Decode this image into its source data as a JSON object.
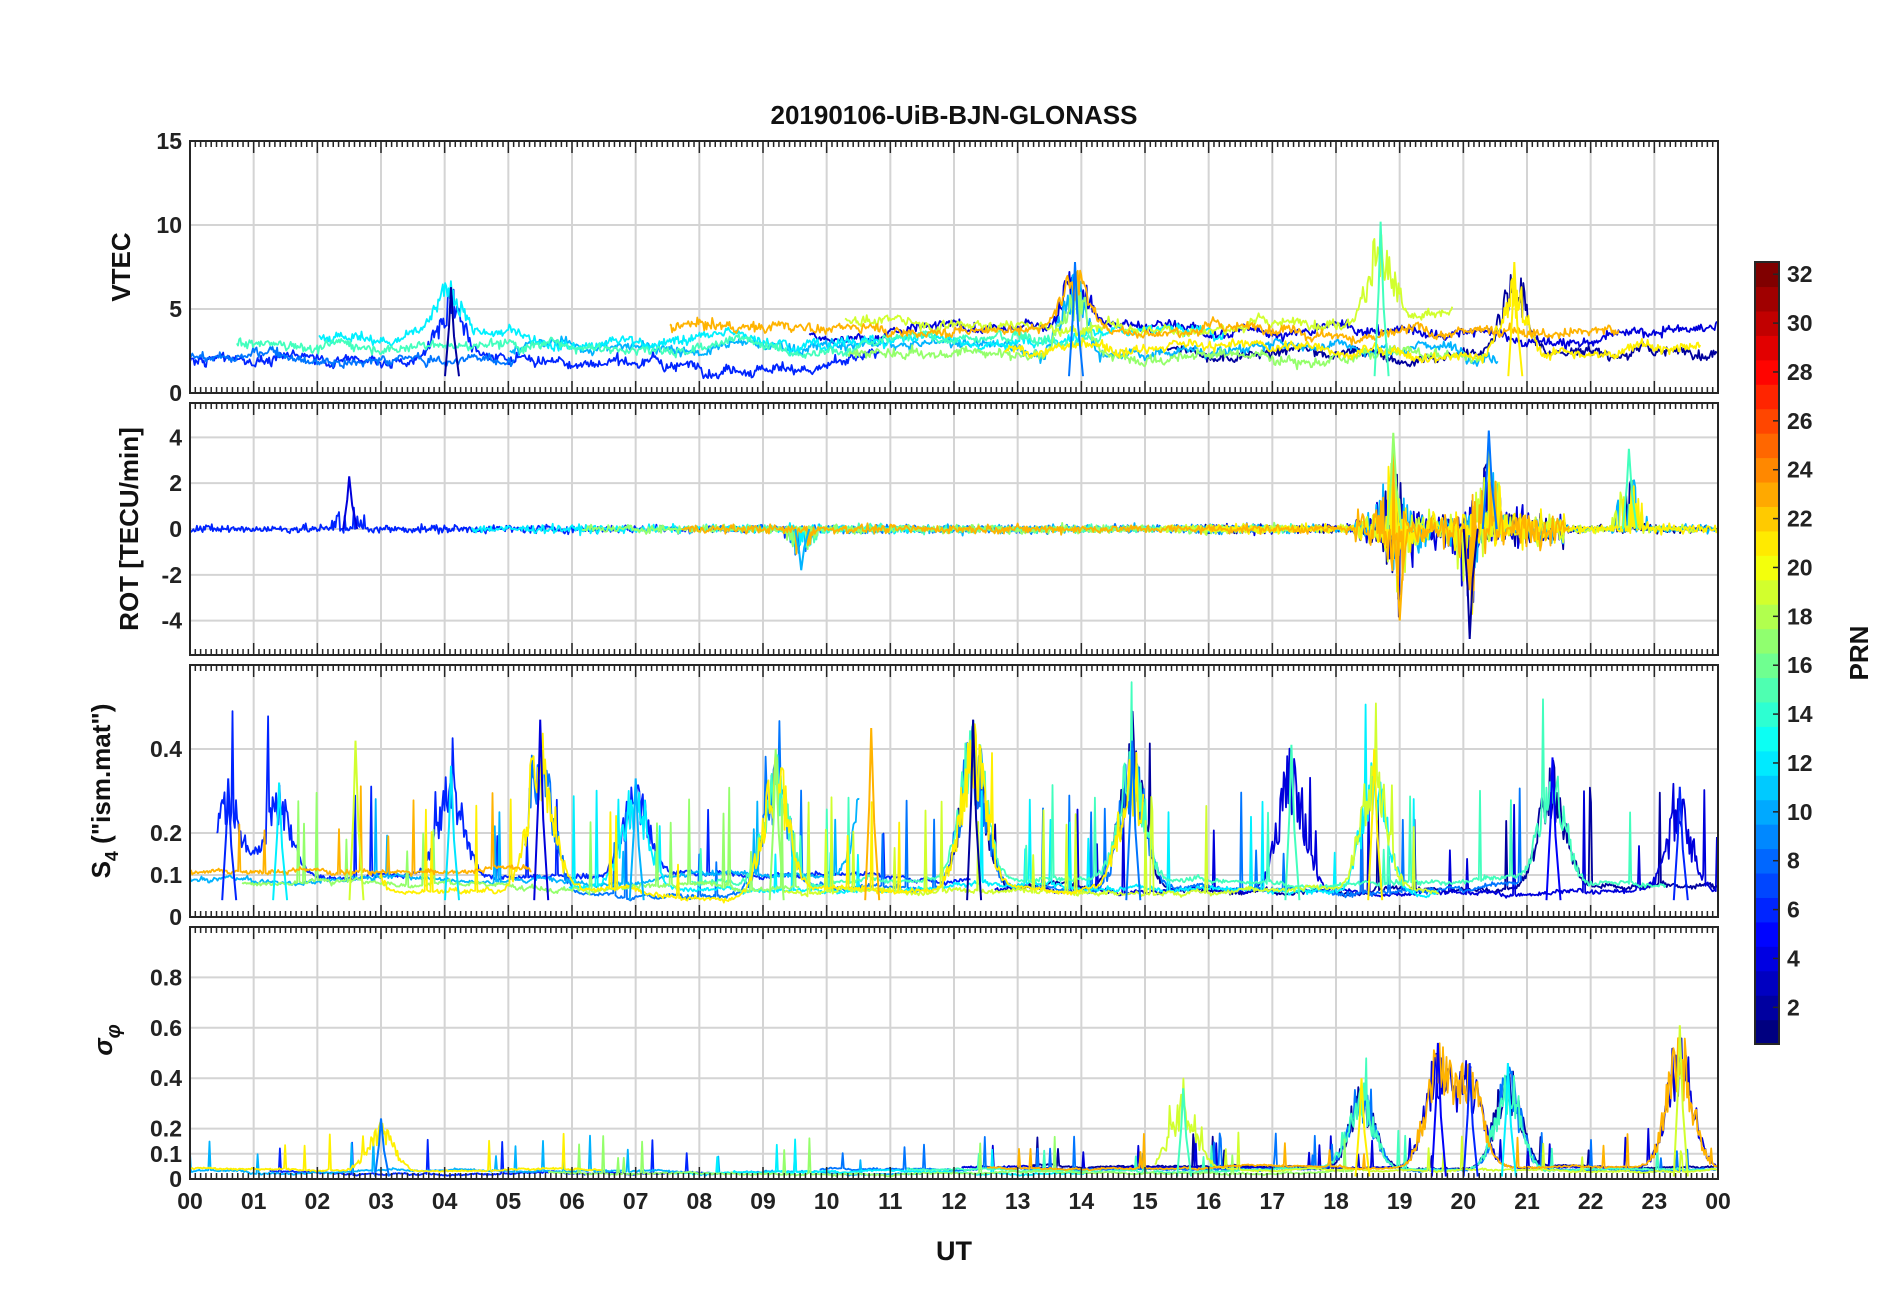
{
  "chart_data": {
    "type": "line",
    "title": "20190106-UiB-BJN-GLONASS",
    "xlabel": "UT",
    "x_ticks": [
      "00",
      "01",
      "02",
      "03",
      "04",
      "05",
      "06",
      "07",
      "08",
      "09",
      "10",
      "11",
      "12",
      "13",
      "14",
      "15",
      "16",
      "17",
      "18",
      "19",
      "20",
      "21",
      "22",
      "23",
      "00"
    ],
    "xlim": [
      0,
      24
    ],
    "grid": true,
    "colorbar": {
      "label": "PRN",
      "ticks": [
        "2",
        "4",
        "6",
        "8",
        "10",
        "12",
        "14",
        "16",
        "18",
        "20",
        "22",
        "24",
        "26",
        "28",
        "30",
        "32"
      ],
      "range": [
        1,
        32
      ],
      "colormap": "jet"
    },
    "panels": [
      {
        "ylabel": "VTEC",
        "ylim": [
          0,
          15
        ],
        "yticks": [
          "0",
          "5",
          "10",
          "15"
        ],
        "yticks_values": [
          0,
          5,
          10,
          15
        ],
        "typical_range": [
          1,
          5
        ],
        "events": [
          {
            "ut": 4.1,
            "peak": 6.3
          },
          {
            "ut": 13.9,
            "peak": 7.8
          },
          {
            "ut": 18.7,
            "peak": 10.2
          },
          {
            "ut": 20.8,
            "peak": 7.8
          }
        ]
      },
      {
        "ylabel": "ROT [TECU/min]",
        "ylim": [
          -5.5,
          5.5
        ],
        "yticks": [
          "-4",
          "-2",
          "0",
          "2",
          "4"
        ],
        "yticks_values": [
          -4,
          -2,
          0,
          2,
          4
        ],
        "typical_range": [
          -0.5,
          0.5
        ],
        "events": [
          {
            "ut": 2.5,
            "peak": 2.3
          },
          {
            "ut": 9.6,
            "peak": -1.8
          },
          {
            "ut": 18.9,
            "peak": 4.2
          },
          {
            "ut": 19.0,
            "peak": -4.0
          },
          {
            "ut": 20.1,
            "peak": -4.8
          },
          {
            "ut": 20.4,
            "peak": 4.3
          },
          {
            "ut": 22.6,
            "peak": 3.5
          }
        ]
      },
      {
        "ylabel_main": "S",
        "ylabel_sub": "4",
        "ylabel_rest": " (\"ism.mat\")",
        "ylim": [
          0,
          0.6
        ],
        "yticks": [
          "0",
          "0.1",
          "0.2",
          "0.4"
        ],
        "yticks_values": [
          0,
          0.1,
          0.2,
          0.4
        ],
        "typical_range": [
          0.04,
          0.12
        ],
        "events": [
          {
            "ut": 0.6,
            "peak": 0.33
          },
          {
            "ut": 1.4,
            "peak": 0.32
          },
          {
            "ut": 2.6,
            "peak": 0.42
          },
          {
            "ut": 4.1,
            "peak": 0.36
          },
          {
            "ut": 5.5,
            "peak": 0.47
          },
          {
            "ut": 7.0,
            "peak": 0.33
          },
          {
            "ut": 9.2,
            "peak": 0.4
          },
          {
            "ut": 10.7,
            "peak": 0.45
          },
          {
            "ut": 12.3,
            "peak": 0.47
          },
          {
            "ut": 14.8,
            "peak": 0.42
          },
          {
            "ut": 17.3,
            "peak": 0.41
          },
          {
            "ut": 18.6,
            "peak": 0.4
          },
          {
            "ut": 21.4,
            "peak": 0.38
          },
          {
            "ut": 23.4,
            "peak": 0.31
          }
        ]
      },
      {
        "ylabel_main": "σ",
        "ylabel_sub": "φ",
        "ylim": [
          0,
          1
        ],
        "yticks": [
          "0",
          "0.1",
          "0.2",
          "0.4",
          "0.6",
          "0.8"
        ],
        "yticks_values": [
          0,
          0.1,
          0.2,
          0.4,
          0.6,
          0.8
        ],
        "typical_range": [
          0.01,
          0.06
        ],
        "events": [
          {
            "ut": 3.0,
            "peak": 0.24
          },
          {
            "ut": 15.6,
            "peak": 0.36
          },
          {
            "ut": 18.4,
            "peak": 0.4
          },
          {
            "ut": 19.6,
            "peak": 0.54
          },
          {
            "ut": 20.1,
            "peak": 0.46
          },
          {
            "ut": 20.7,
            "peak": 0.46
          },
          {
            "ut": 23.4,
            "peak": 0.61
          }
        ]
      }
    ]
  }
}
